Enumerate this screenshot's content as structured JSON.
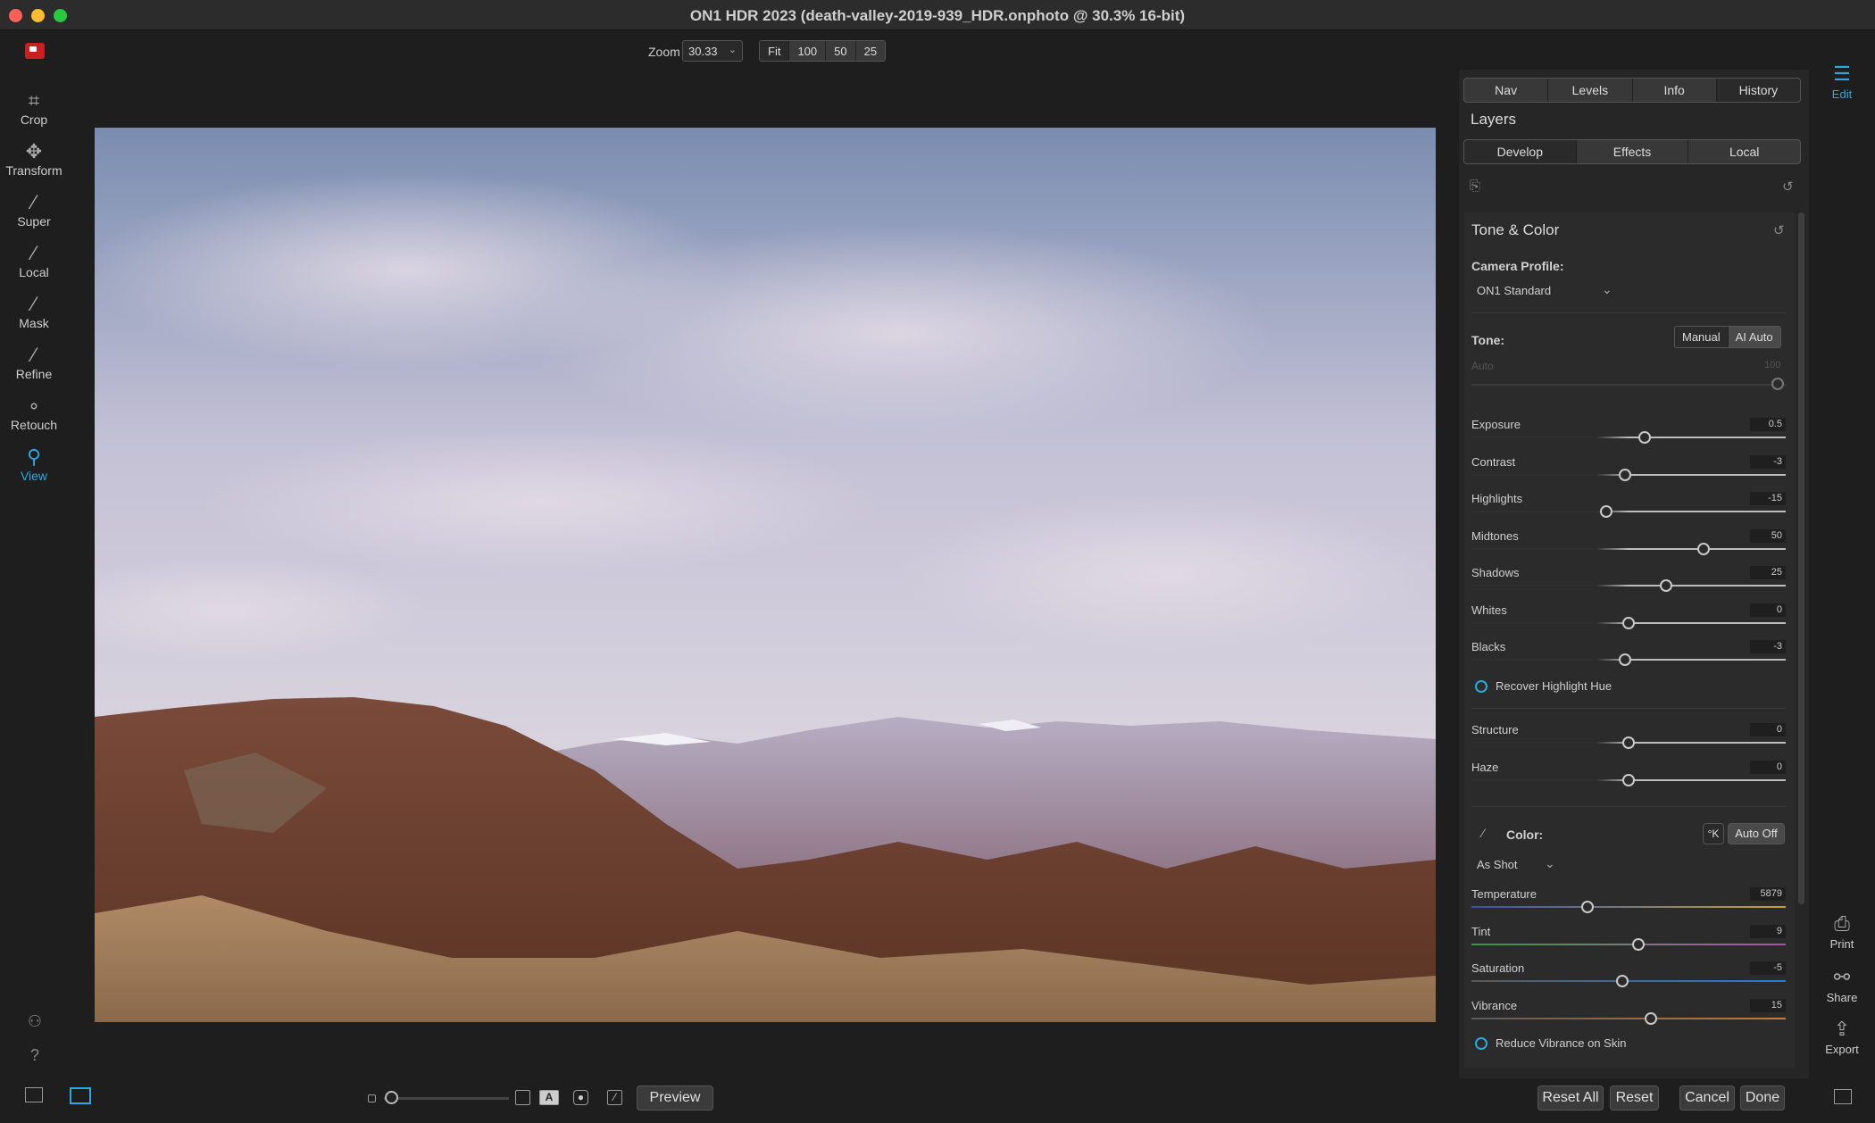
{
  "window": {
    "title": "ON1 HDR 2023 (death-valley-2019-939_HDR.onphoto @ 30.3% 16-bit)"
  },
  "toolbar": {
    "zoom_label": "Zoom",
    "zoom_value": "30.33",
    "zoom_buttons": [
      "Fit",
      "100",
      "50",
      "25"
    ]
  },
  "left_tools": [
    {
      "label": "Crop",
      "icon": "crop-icon"
    },
    {
      "label": "Transform",
      "icon": "transform-icon"
    },
    {
      "label": "Super",
      "icon": "super-icon"
    },
    {
      "label": "Local",
      "icon": "local-brush-icon"
    },
    {
      "label": "Mask",
      "icon": "mask-icon"
    },
    {
      "label": "Refine",
      "icon": "refine-icon"
    },
    {
      "label": "Retouch",
      "icon": "retouch-icon"
    },
    {
      "label": "View",
      "icon": "view-icon",
      "active": true
    }
  ],
  "panel": {
    "top_tabs": [
      "Nav",
      "Levels",
      "Info",
      "History"
    ],
    "layers_label": "Layers",
    "sub_tabs": [
      "Develop",
      "Effects",
      "Local"
    ],
    "section_title": "Tone & Color",
    "camera_profile_label": "Camera Profile:",
    "camera_profile_value": "ON1 Standard",
    "tone_label": "Tone:",
    "tone_manual": "Manual",
    "tone_ai": "AI Auto",
    "auto_label": "Auto",
    "auto_value": "100",
    "sliders": [
      {
        "label": "Exposure",
        "value": "0.5",
        "pos": 0.55
      },
      {
        "label": "Contrast",
        "value": "-3",
        "pos": 0.49
      },
      {
        "label": "Highlights",
        "value": "-15",
        "pos": 0.43
      },
      {
        "label": "Midtones",
        "value": "50",
        "pos": 0.74
      },
      {
        "label": "Shadows",
        "value": "25",
        "pos": 0.62
      },
      {
        "label": "Whites",
        "value": "0",
        "pos": 0.5
      },
      {
        "label": "Blacks",
        "value": "-3",
        "pos": 0.49
      }
    ],
    "recover_label": "Recover Highlight Hue",
    "sliders2": [
      {
        "label": "Structure",
        "value": "0",
        "pos": 0.5
      },
      {
        "label": "Haze",
        "value": "0",
        "pos": 0.5
      }
    ],
    "color_label": "Color:",
    "kelvin_btn": "°K",
    "auto_off_btn": "Auto Off",
    "wb_value": "As Shot",
    "color_sliders": [
      {
        "label": "Temperature",
        "value": "5879",
        "pos": 0.37
      },
      {
        "label": "Tint",
        "value": "9",
        "pos": 0.53
      },
      {
        "label": "Saturation",
        "value": "-5",
        "pos": 0.48
      },
      {
        "label": "Vibrance",
        "value": "15",
        "pos": 0.57
      }
    ],
    "reduce_label": "Reduce Vibrance on Skin"
  },
  "right_rail": [
    {
      "label": "Edit",
      "icon": "edit-sliders-icon",
      "active": true
    },
    {
      "label": "Print",
      "icon": "print-icon"
    },
    {
      "label": "Share",
      "icon": "share-icon"
    },
    {
      "label": "Export",
      "icon": "export-icon"
    }
  ],
  "bottom": {
    "preview": "Preview",
    "reset_all": "Reset All",
    "reset": "Reset",
    "cancel": "Cancel",
    "done": "Done"
  },
  "colors": {
    "accent": "#2aa9e0",
    "panel": "#262626",
    "bg": "#1e1e1e"
  }
}
